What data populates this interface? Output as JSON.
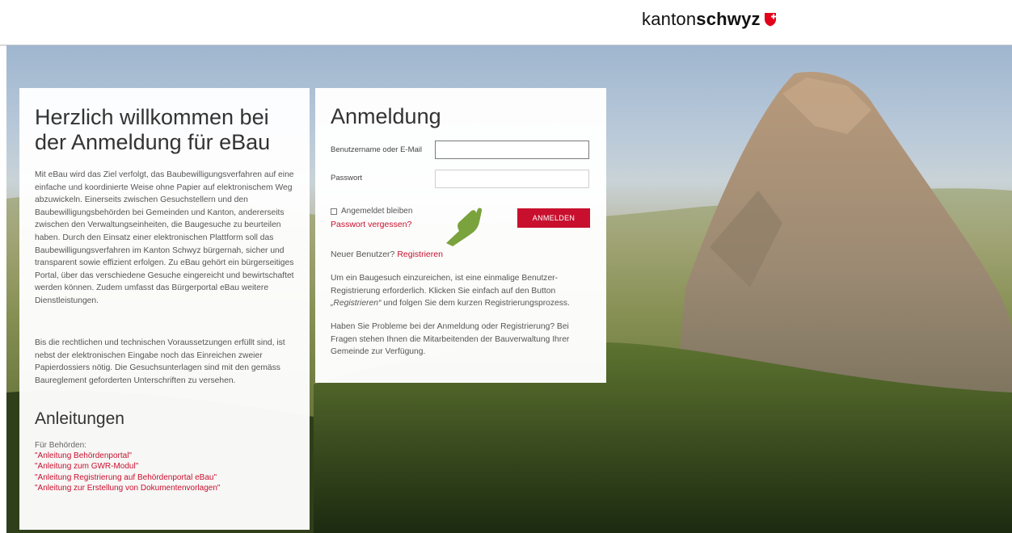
{
  "header": {
    "logo_light": "kanton",
    "logo_bold": "schwyz"
  },
  "welcome": {
    "title": "Herzlich willkommen bei der Anmeldung für eBau",
    "paragraph1": "Mit eBau wird das Ziel verfolgt, das Baubewilligungsverfahren auf eine einfache und koordinierte Weise ohne Papier auf elektronischem Weg abzuwickeln. Einerseits zwischen Gesuchstellern und den Baubewilligungsbehörden bei Gemeinden und Kanton, andererseits zwischen den Verwaltungseinheiten, die Baugesuche zu beurteilen haben. Durch den Einsatz einer elektronischen Plattform soll das Baubewilligungsverfahren im Kanton Schwyz bürgernah, sicher und transparent sowie effizient erfolgen. Zu eBau gehört ein bürgerseitiges Portal, über das verschiedene Gesuche eingereicht und bewirtschaftet werden können. Zudem umfasst das Bürgerportal eBau weitere Dienstleistungen.",
    "paragraph2": "Bis die rechtlichen und technischen Voraussetzungen erfüllt sind, ist nebst der elektronischen Eingabe noch das Einreichen zweier Papierdossiers nötig. Die Gesuchsunterlagen sind mit den gemäss Baureglement geforderten Unterschriften zu versehen."
  },
  "guides": {
    "title": "Anleitungen",
    "label": "Für Behörden:",
    "links": [
      "\"Anleitung Behördenportal\"",
      "\"Anleitung zum GWR-Modul\"",
      "\"Anleitung Registrierung auf Behördenportal eBau\"",
      "\"Anleitung zur Erstellung von Dokumentenvorlagen\""
    ]
  },
  "login": {
    "title": "Anmeldung",
    "username_label": "Benutzername oder E-Mail",
    "username_value": "",
    "password_label": "Passwort",
    "password_value": "",
    "remember_label": "Angemeldet bleiben",
    "forgot_label": "Passwort vergessen?",
    "submit_label": "ANMELDEN",
    "new_user_prefix": "Neuer Benutzer?",
    "register_link": "Registrieren",
    "info1_a": "Um ein Baugesuch einzureichen, ist eine einmalige Benutzer-Registrierung erforderlich. Klicken Sie einfach auf den Button ",
    "info1_em": "„Registrieren“",
    "info1_b": " und folgen Sie dem kurzen Registrierungsprozess.",
    "info2": "Haben Sie Probleme bei der Anmeldung oder Registrierung? Bei Fragen stehen Ihnen die Mitarbeitenden der Bauverwaltung Ihrer Gemeinde zur Verfügung."
  },
  "colors": {
    "accent": "#c8102e",
    "pointer": "#6f9a2c"
  },
  "icons": {
    "logo_shield": "schwyz-shield-icon",
    "pointer": "pointing-hand-icon"
  }
}
